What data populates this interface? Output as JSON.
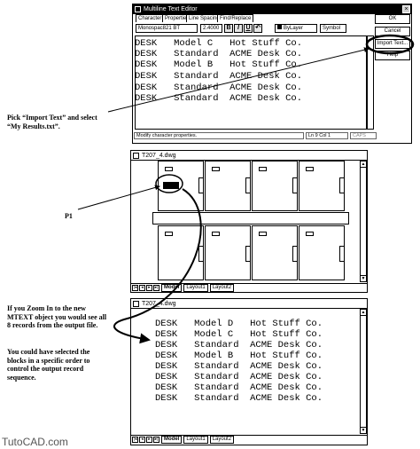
{
  "mtext_dialog": {
    "title": "Multiline Text Editor",
    "tabs": [
      "Character",
      "Properties",
      "Line Spacing",
      "Find/Replace"
    ],
    "font": "Monospac821 BT",
    "height": "2.4000",
    "bold": "B",
    "italic": "I",
    "underline": "U",
    "layer": "ByLayer",
    "symbol": "Symbol",
    "buttons": [
      "OK",
      "Cancel",
      "Import Text...",
      "Help"
    ],
    "lines": [
      "DESK   Model C   Hot Stuff Co.",
      "DESK   Standard  ACME Desk Co.",
      "DESK   Model B   Hot Stuff Co.",
      "DESK   Standard  ACME Desk Co.",
      "DESK   Standard  ACME Desk Co.",
      "DESK   Standard  ACME Desk Co."
    ],
    "status_left": "Modify character properties.",
    "status_pos": "Ln 9 Col 1",
    "status_caps": "CAPS"
  },
  "drawing1": {
    "title": "T207_4.dwg",
    "tabs": [
      "Model",
      "Layout1",
      "Layout2"
    ]
  },
  "drawing2": {
    "title": "T207_4.dwg",
    "tabs": [
      "Model",
      "Layout1",
      "Layout2"
    ],
    "records": [
      "DESK   Model D   Hot Stuff Co.",
      "DESK   Model C   Hot Stuff Co.",
      "DESK   Standard  ACME Desk Co.",
      "DESK   Model B   Hot Stuff Co.",
      "DESK   Standard  ACME Desk Co.",
      "DESK   Standard  ACME Desk Co.",
      "DESK   Standard  ACME Desk Co.",
      "DESK   Standard  ACME Desk Co."
    ]
  },
  "captions": {
    "import_text": "Pick “Import Text” and select “My Results.txt”.",
    "p1": "P1",
    "zoom_in": "If you Zoom In to the new MTEXT object you would see all 8 records from the output file.",
    "order": "You could have selected the blocks in a specific order to control the output record sequence.",
    "watermark": "TutoCAD.com"
  }
}
